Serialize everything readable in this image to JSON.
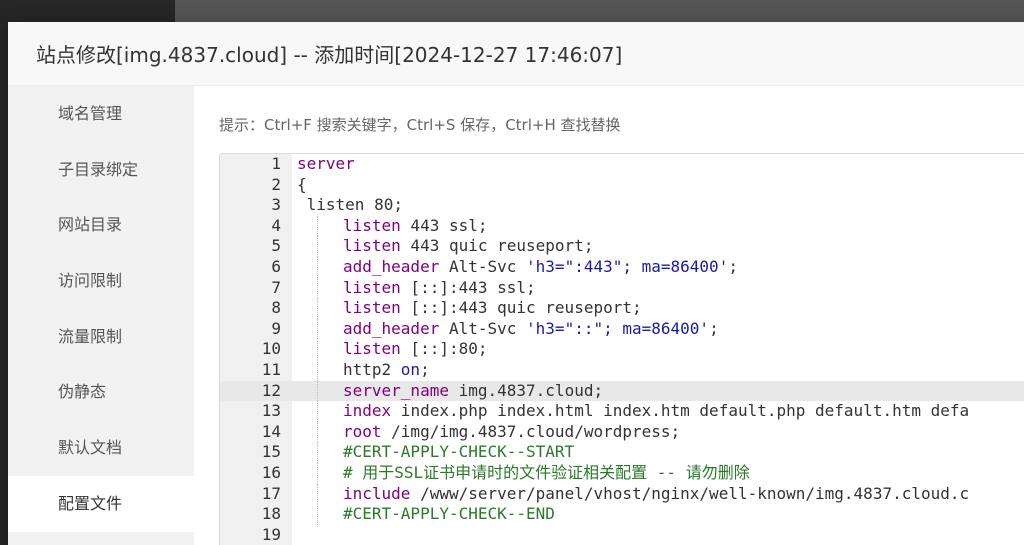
{
  "dialog": {
    "title": "站点修改[img.4837.cloud] -- 添加时间[2024-12-27 17:46:07]"
  },
  "menu": {
    "items": [
      {
        "label": "域名管理",
        "active": false
      },
      {
        "label": "子目录绑定",
        "active": false
      },
      {
        "label": "网站目录",
        "active": false
      },
      {
        "label": "访问限制",
        "active": false
      },
      {
        "label": "流量限制",
        "active": false
      },
      {
        "label": "伪静态",
        "active": false
      },
      {
        "label": "默认文档",
        "active": false
      },
      {
        "label": "配置文件",
        "active": true
      }
    ]
  },
  "tip": "提示：Ctrl+F 搜索关键字，Ctrl+S 保存，Ctrl+H 查找替换",
  "editor": {
    "highlighted_line": 12,
    "lines": [
      {
        "n": "1",
        "indent": 0,
        "segs": [
          [
            "k",
            "server"
          ]
        ]
      },
      {
        "n": "2",
        "indent": 0,
        "segs": [
          [
            "p",
            "{"
          ]
        ]
      },
      {
        "n": "3",
        "indent": 0,
        "segs": [
          [
            "p",
            " listen 80;"
          ]
        ]
      },
      {
        "n": "4",
        "indent": 1,
        "segs": [
          [
            "k",
            "listen"
          ],
          [
            "p",
            " 443 ssl;"
          ]
        ]
      },
      {
        "n": "5",
        "indent": 1,
        "segs": [
          [
            "k",
            "listen"
          ],
          [
            "p",
            " 443 quic reuseport;"
          ]
        ]
      },
      {
        "n": "6",
        "indent": 1,
        "segs": [
          [
            "k",
            "add_header"
          ],
          [
            "p",
            " Alt-Svc "
          ],
          [
            "s",
            "'h3=\":443\"; ma=86400'"
          ],
          [
            "p",
            ";"
          ]
        ]
      },
      {
        "n": "7",
        "indent": 1,
        "segs": [
          [
            "k",
            "listen"
          ],
          [
            "p",
            " [::]:443 ssl;"
          ]
        ]
      },
      {
        "n": "8",
        "indent": 1,
        "segs": [
          [
            "k",
            "listen"
          ],
          [
            "p",
            " [::]:443 quic reuseport;"
          ]
        ]
      },
      {
        "n": "9",
        "indent": 1,
        "segs": [
          [
            "k",
            "add_header"
          ],
          [
            "p",
            " Alt-Svc "
          ],
          [
            "s",
            "'h3=\"::\"; ma=86400'"
          ],
          [
            "p",
            ";"
          ]
        ]
      },
      {
        "n": "10",
        "indent": 1,
        "segs": [
          [
            "k",
            "listen"
          ],
          [
            "p",
            " [::]:80;"
          ]
        ]
      },
      {
        "n": "11",
        "indent": 1,
        "segs": [
          [
            "p",
            "http2 "
          ],
          [
            "s",
            "on"
          ],
          [
            "p",
            ";"
          ]
        ]
      },
      {
        "n": "12",
        "indent": 1,
        "segs": [
          [
            "k",
            "server_name"
          ],
          [
            "p",
            " img.4837.cloud;"
          ]
        ]
      },
      {
        "n": "13",
        "indent": 1,
        "segs": [
          [
            "k",
            "index"
          ],
          [
            "p",
            " index.php index.html index.htm default.php default.htm defa"
          ]
        ]
      },
      {
        "n": "14",
        "indent": 1,
        "segs": [
          [
            "k",
            "root"
          ],
          [
            "p",
            " /img/img.4837.cloud/wordpress;"
          ]
        ]
      },
      {
        "n": "15",
        "indent": 1,
        "segs": [
          [
            "c",
            "#CERT-APPLY-CHECK--START"
          ]
        ]
      },
      {
        "n": "16",
        "indent": 1,
        "segs": [
          [
            "c",
            "# 用于SSL证书申请时的文件验证相关配置 -- 请勿删除"
          ]
        ]
      },
      {
        "n": "17",
        "indent": 1,
        "segs": [
          [
            "k",
            "include"
          ],
          [
            "p",
            " /www/server/panel/vhost/nginx/well-known/img.4837.cloud.c"
          ]
        ]
      },
      {
        "n": "18",
        "indent": 1,
        "segs": [
          [
            "c",
            "#CERT-APPLY-CHECK--END"
          ]
        ]
      },
      {
        "n": "19",
        "indent": 0,
        "segs": []
      }
    ]
  },
  "colors": {
    "keyword": "#800080",
    "string": "#1a1aa6",
    "comment": "#2a7a2a",
    "active_menu_bg": "#ffffff",
    "menu_bg": "#f2f2f2"
  }
}
